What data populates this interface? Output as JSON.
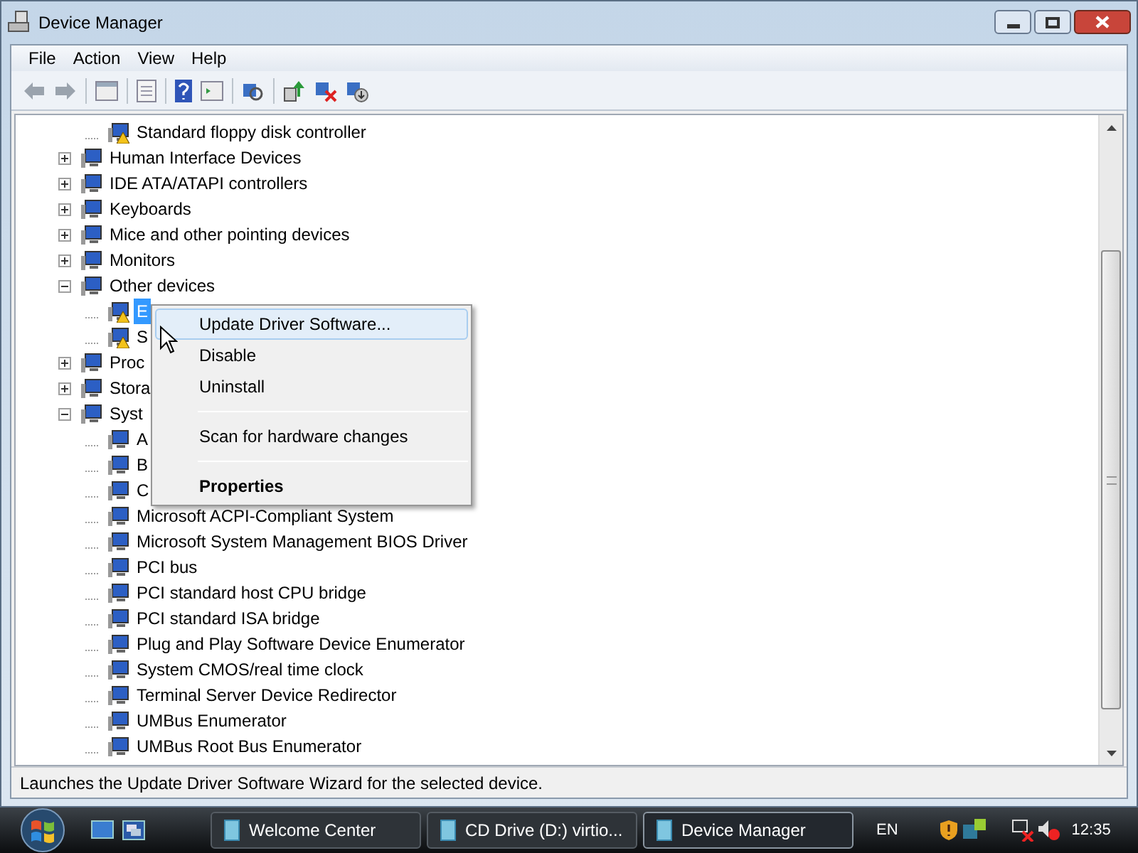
{
  "window": {
    "title": "Device Manager"
  },
  "menu": [
    "File",
    "Action",
    "View",
    "Help"
  ],
  "tree": [
    {
      "children": [
        {
          "label": "Standard floppy disk controller",
          "warning": true,
          "selected": false
        }
      ]
    },
    {
      "label": "Human Interface Devices",
      "expanded": false
    },
    {
      "label": "IDE ATA/ATAPI controllers",
      "expanded": false
    },
    {
      "label": "Keyboards",
      "expanded": false
    },
    {
      "label": "Mice and other pointing devices",
      "expanded": false
    },
    {
      "label": "Monitors",
      "expanded": false
    },
    {
      "label": "Other devices",
      "expanded": true,
      "children": [
        {
          "label": "E",
          "warning": true,
          "selected": true
        },
        {
          "label": "S",
          "warning": true,
          "selected": false
        }
      ]
    },
    {
      "label": "Proc",
      "expanded": false
    },
    {
      "label": "Stora",
      "expanded": false
    },
    {
      "label": "Syst",
      "expanded": true,
      "children": [
        {
          "label": "A"
        },
        {
          "label": "B"
        },
        {
          "label": "C"
        },
        {
          "label": "Microsoft ACPI-Compliant System"
        },
        {
          "label": "Microsoft System Management BIOS Driver"
        },
        {
          "label": "PCI bus"
        },
        {
          "label": "PCI standard host CPU bridge"
        },
        {
          "label": "PCI standard ISA bridge"
        },
        {
          "label": "Plug and Play Software Device Enumerator"
        },
        {
          "label": "System CMOS/real time clock"
        },
        {
          "label": "Terminal Server Device Redirector"
        },
        {
          "label": "UMBus Enumerator"
        },
        {
          "label": "UMBus Root Bus Enumerator"
        }
      ]
    }
  ],
  "context_menu": [
    {
      "kind": "item",
      "label": "Update Driver Software...",
      "selected": true
    },
    {
      "kind": "item",
      "label": "Disable",
      "selected": false
    },
    {
      "kind": "item",
      "label": "Uninstall",
      "selected": false
    },
    {
      "kind": "separator"
    },
    {
      "kind": "item",
      "label": "Scan for hardware changes",
      "selected": false
    },
    {
      "kind": "separator"
    },
    {
      "kind": "default",
      "label": "Properties",
      "selected": false
    }
  ],
  "status_bar": "Launches the Update Driver Software Wizard for the selected device.",
  "taskbar": {
    "buttons": [
      {
        "label": "Welcome Center",
        "selected": false
      },
      {
        "label": "CD Drive (D:) virtio...",
        "selected": false
      },
      {
        "label": "Device Manager",
        "selected": true
      }
    ],
    "language": "EN",
    "clock": "12:35"
  }
}
